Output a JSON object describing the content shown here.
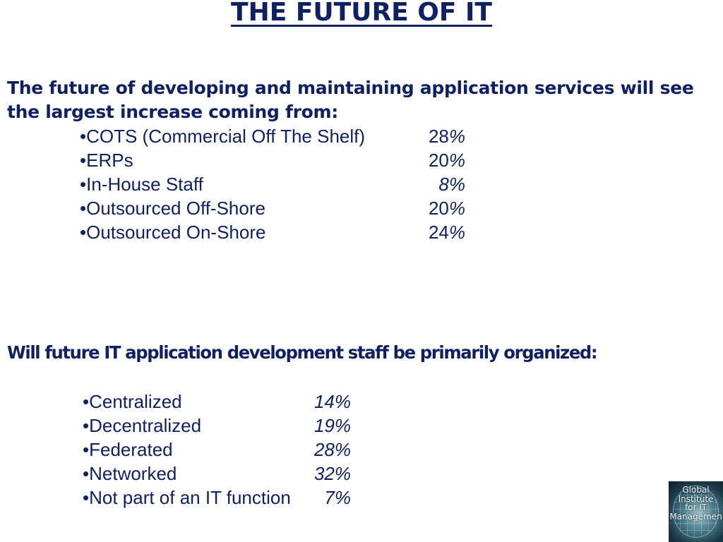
{
  "title": "THE FUTURE OF IT",
  "section1": {
    "heading": "The future of developing and maintaining application services will see the largest increase coming from:",
    "items": [
      {
        "label": "•COTS (Commercial Off The Shelf)",
        "value": "28",
        "unit": "%"
      },
      {
        "label": "•ERPs",
        "value": "20",
        "unit": "%"
      },
      {
        "label": "•In-House Staff",
        "value": "8",
        "unit": "%"
      },
      {
        "label": "•Outsourced Off-Shore",
        "value": "20",
        "unit": "%"
      },
      {
        "label": "•Outsourced On-Shore",
        "value": "24",
        "unit": "%"
      }
    ]
  },
  "section2": {
    "heading": "Will future IT application development staff be primarily organized:",
    "items": [
      {
        "label": "•Centralized",
        "value": "14%"
      },
      {
        "label": "•Decentralized",
        "value": "19%"
      },
      {
        "label": "•Federated",
        "value": "28%"
      },
      {
        "label": "•Networked",
        "value": "32%"
      },
      {
        "label": "•Not part of an IT function",
        "value": "7%"
      }
    ]
  },
  "logo": {
    "icon": "globe-icon",
    "lines": [
      "Global",
      "Institute",
      "for IT",
      "Managemen"
    ]
  }
}
